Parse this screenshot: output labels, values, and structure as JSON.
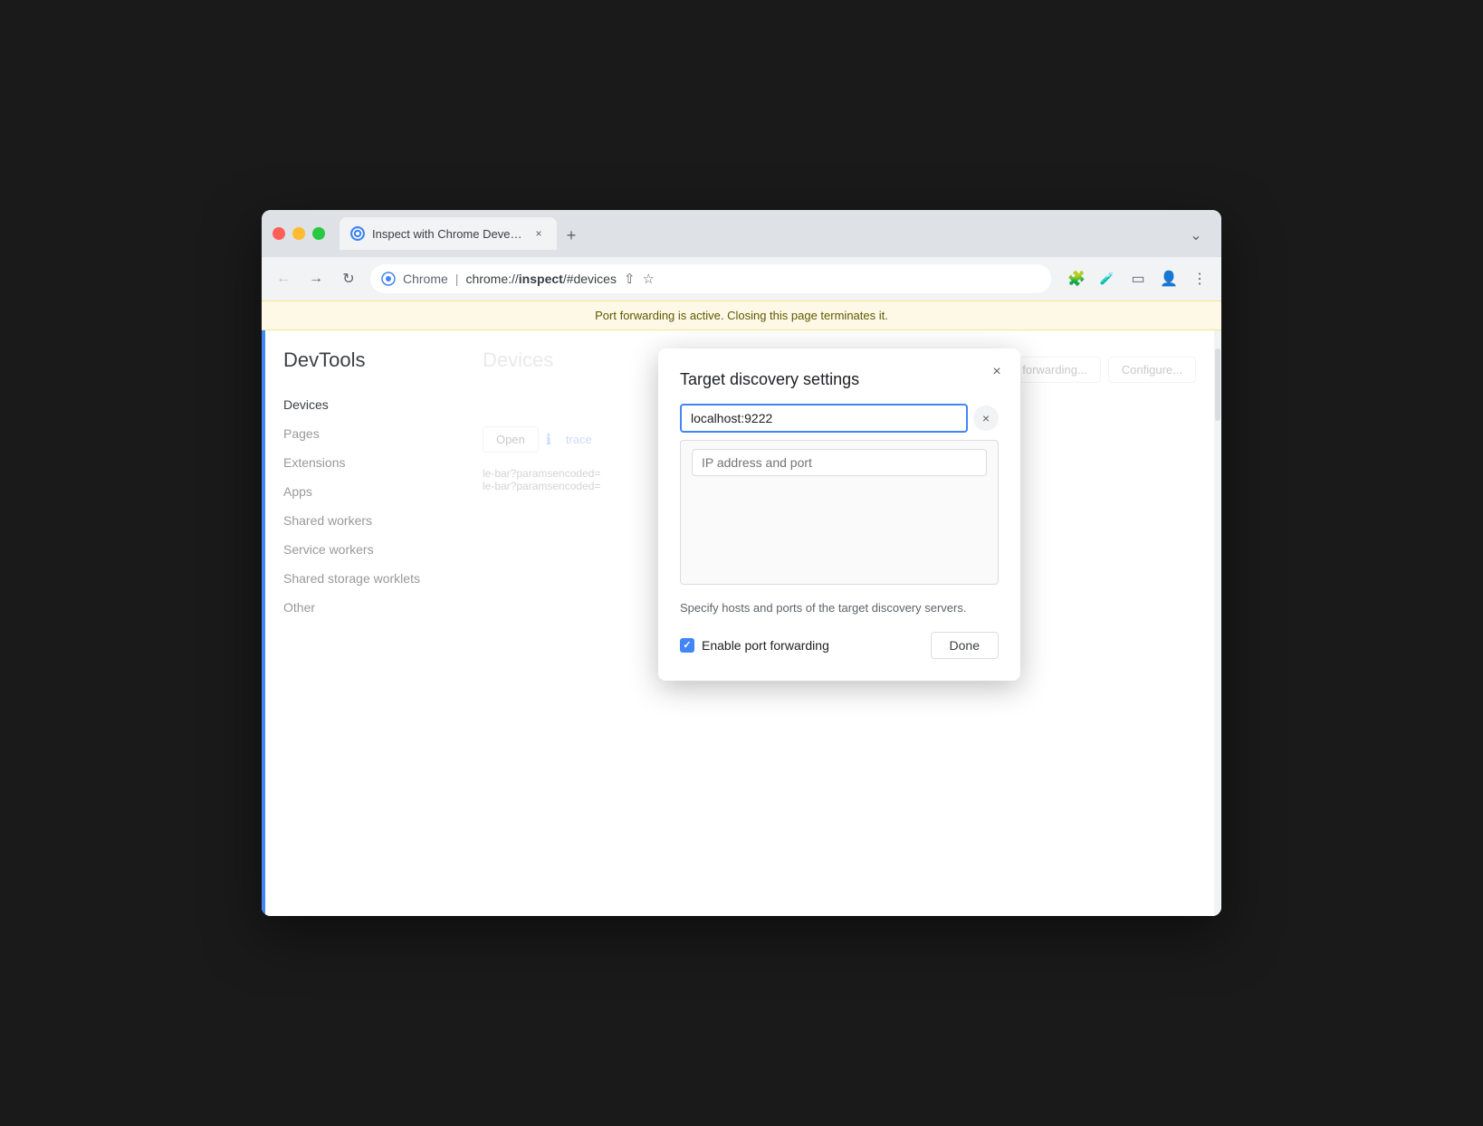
{
  "browser": {
    "tab_title": "Inspect with Chrome Develope",
    "tab_icon": "●",
    "url_scheme": "Chrome",
    "url_full": "chrome://inspect/#devices",
    "url_display": "chrome://",
    "url_bold": "inspect",
    "url_path": "/#devices"
  },
  "info_bar": {
    "message": "Port forwarding is active. Closing this page terminates it."
  },
  "sidebar": {
    "title": "DevTools",
    "items": [
      {
        "label": "Devices",
        "active": true
      },
      {
        "label": "Pages",
        "active": false
      },
      {
        "label": "Extensions",
        "active": false
      },
      {
        "label": "Apps",
        "active": false
      },
      {
        "label": "Shared workers",
        "active": false
      },
      {
        "label": "Service workers",
        "active": false
      },
      {
        "label": "Shared storage worklets",
        "active": false
      },
      {
        "label": "Other",
        "active": false
      }
    ]
  },
  "main": {
    "page_title": "Devices",
    "btn_forwarding": "Port forwarding...",
    "btn_configure": "Configure...",
    "btn_open": "Open",
    "link_trace": "trace",
    "url1": "le-bar?paramsencoded=",
    "url2": "le-bar?paramsencoded="
  },
  "modal": {
    "title": "Target discovery settings",
    "close_icon": "×",
    "input_value": "localhost:9222",
    "input_placeholder": "IP address and port",
    "description": "Specify hosts and ports of the target\ndiscovery servers.",
    "checkbox_label": "Enable port forwarding",
    "checkbox_checked": true,
    "done_btn": "Done"
  }
}
